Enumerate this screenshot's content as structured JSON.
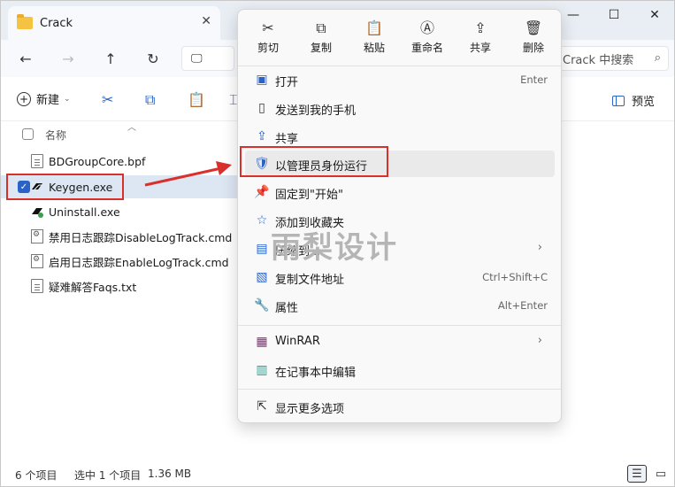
{
  "window": {
    "tab_title": "Crack",
    "search_placeholder": "Crack 中搜索"
  },
  "toolbar": {
    "new_label": "新建",
    "preview_label": "预览"
  },
  "filelist": {
    "column_name": "名称",
    "files": [
      {
        "name": "BDGroupCore.bpf"
      },
      {
        "name": "Keygen.exe"
      },
      {
        "name": "Uninstall.exe"
      },
      {
        "name": "禁用日志跟踪DisableLogTrack.cmd"
      },
      {
        "name": "启用日志跟踪EnableLogTrack.cmd"
      },
      {
        "name": "疑难解答Faqs.txt"
      }
    ]
  },
  "status": {
    "count": "6 个项目",
    "selected": "选中 1 个项目",
    "size": "1.36 MB"
  },
  "context_menu": {
    "quick": [
      {
        "label": "剪切",
        "icon": "scissors-icon"
      },
      {
        "label": "复制",
        "icon": "copy-icon"
      },
      {
        "label": "粘贴",
        "icon": "paste-icon"
      },
      {
        "label": "重命名",
        "icon": "rename-icon"
      },
      {
        "label": "共享",
        "icon": "share-icon"
      },
      {
        "label": "删除",
        "icon": "trash-icon"
      }
    ],
    "items": [
      {
        "label": "打开",
        "key": "Enter"
      },
      {
        "label": "发送到我的手机",
        "key": ""
      },
      {
        "label": "共享",
        "key": ""
      },
      {
        "label": "以管理员身份运行",
        "key": ""
      },
      {
        "label": "固定到\"开始\"",
        "key": ""
      },
      {
        "label": "添加到收藏夹",
        "key": ""
      },
      {
        "label": "压缩到...",
        "key": ""
      },
      {
        "label": "复制文件地址",
        "key": "Ctrl+Shift+C"
      },
      {
        "label": "属性",
        "key": "Alt+Enter"
      },
      {
        "label": "WinRAR",
        "key": ""
      },
      {
        "label": "在记事本中编辑",
        "key": ""
      },
      {
        "label": "显示更多选项",
        "key": ""
      }
    ]
  },
  "watermark": "雨梨设计",
  "colors": {
    "accent": "#2a63c7",
    "highlight_red": "#d9302c"
  }
}
